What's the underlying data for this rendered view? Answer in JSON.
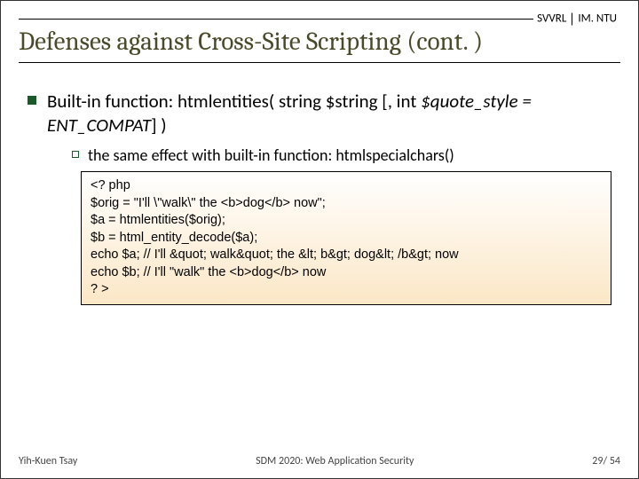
{
  "header": {
    "left": "SVVRL",
    "right": "IM. NTU"
  },
  "title": "Defenses against Cross-Site Scripting (cont. )",
  "bullet1": {
    "prefix": "Built-in function: htmlentities( string $string [, int ",
    "italic": "$quote_style = ENT_COMPAT",
    "suffix": "] )"
  },
  "bullet2": "the same effect with built-in function: htmlspecialchars()",
  "code": "<? php\n$orig = \"I'll \\\"walk\\\" the <b>dog</b> now\";\n$a = htmlentities($orig);\n$b = html_entity_decode($a);\necho $a; // I'll &quot; walk&quot; the &lt; b&gt; dog&lt; /b&gt; now\necho $b; // I'll \"walk\" the <b>dog</b> now\n? >",
  "footer": {
    "left": "Yih-Kuen Tsay",
    "center": "SDM 2020: Web Application Security",
    "right_page": "29",
    "right_sep": "/ ",
    "right_total": "54"
  }
}
